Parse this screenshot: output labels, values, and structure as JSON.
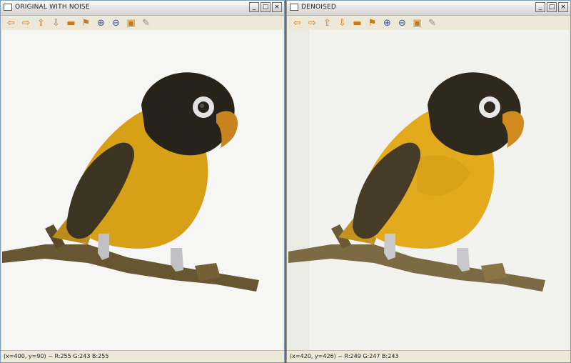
{
  "windows": [
    {
      "title": "ORIGINAL WITH NOISE",
      "status": "(x=400, y=90) ~ R:255 G:243 B:255"
    },
    {
      "title": "DENOISED",
      "status": "(x=420, y=426) ~ R:249 G:247 B:243"
    }
  ],
  "window_buttons": {
    "minimize": "_",
    "maximize": "□",
    "close": "×"
  },
  "toolbar_icons": [
    "arrow-left-icon",
    "arrow-right-icon",
    "arrow-up-icon",
    "arrow-down-icon",
    "save-icon",
    "image-icon",
    "zoom-in-icon",
    "zoom-out-icon",
    "floppy-icon",
    "properties-icon"
  ],
  "colors": {
    "bird_body": "#e0a71a",
    "bird_head": "#2a251b",
    "bird_wing": "#3f3624",
    "beak": "#d08a1e",
    "branch": "#6b5a34",
    "title_bar": "#e6e6e6"
  }
}
